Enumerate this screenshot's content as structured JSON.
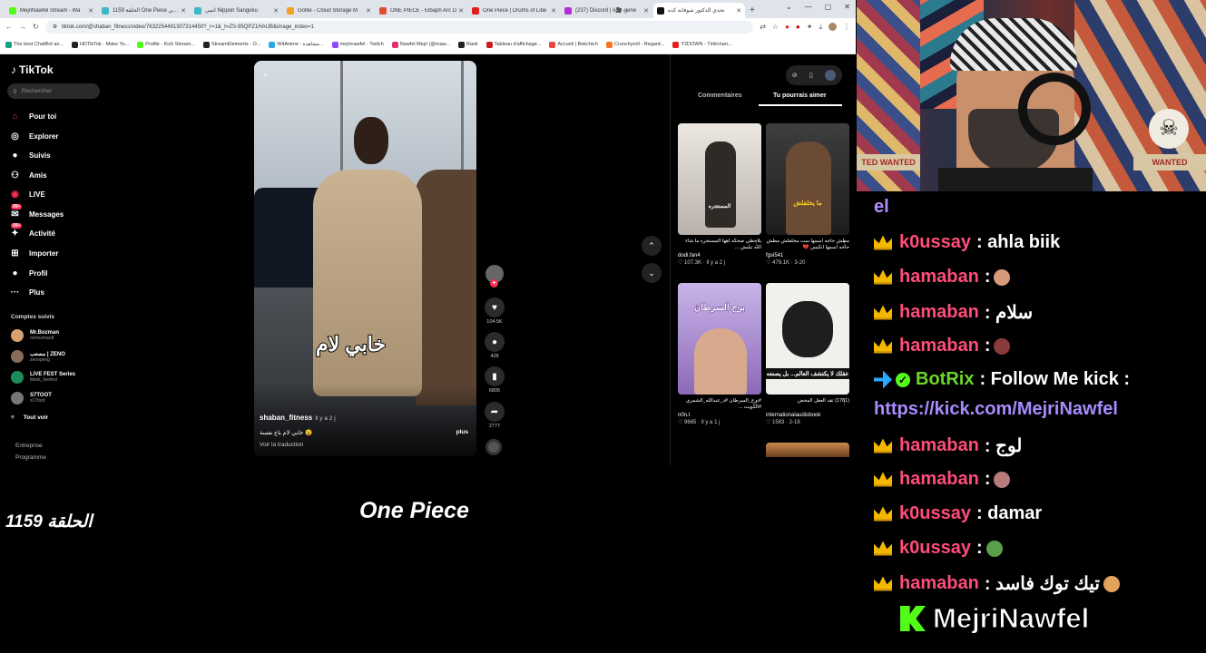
{
  "browser": {
    "tabs": [
      {
        "label": "MejriNawfel Stream - Wa",
        "color": "#53fc18"
      },
      {
        "label": "الحلقة 1159 One Piece الحي",
        "color": "#3db8c9"
      },
      {
        "label": "انمي Nippon Sangoku",
        "color": "#3db8c9"
      },
      {
        "label": "Gofile - Cloud Storage M",
        "color": "#f4a025"
      },
      {
        "label": "ONE PIECE - Elbaph Arc D",
        "color": "#e34b2f"
      },
      {
        "label": "One Piece | Drums of Libe",
        "color": "#e02020"
      },
      {
        "label": "(237) Discord | #🎥-gene",
        "color": "#b12fd4"
      },
      {
        "label": "تحدي الدكتور شوفانه كده",
        "color": "#111111",
        "active": true
      }
    ],
    "url": "tiktok.com/@shaban_fitness/video/7632254491307314450?_r=1&_t=ZS-95QPZ1HAUB&image_index=1",
    "bookmarks": [
      {
        "label": "The best ChatBot an...",
        "color": "#10a37f"
      },
      {
        "label": "HDTikTok - Make Yo...",
        "color": "#222222"
      },
      {
        "label": "Profile - Kick Stream...",
        "color": "#53fc18"
      },
      {
        "label": "StreamElements - O...",
        "color": "#222222"
      },
      {
        "label": "WitAnime - مشاهدة...",
        "color": "#2ca9e1"
      },
      {
        "label": "mejrinawfel - Twitch",
        "color": "#9146ff"
      },
      {
        "label": "Nawfel Mejri (@maw...",
        "color": "#e1306c"
      },
      {
        "label": "Rank",
        "color": "#222222"
      },
      {
        "label": "Tableau d'affichage...",
        "color": "#c41e1e"
      },
      {
        "label": "Accueil | Bekchich",
        "color": "#e8473c"
      },
      {
        "label": "Crunchyroll - Regard...",
        "color": "#f47521"
      },
      {
        "label": "Y2DOWN - Télécharr...",
        "color": "#e02020"
      }
    ]
  },
  "tiktok": {
    "logo": "TikTok",
    "search_placeholder": "Rechercher",
    "nav": [
      {
        "label": "Pour toi",
        "icon": "home-icon",
        "glyph": "⌂"
      },
      {
        "label": "Explorer",
        "icon": "compass-icon",
        "glyph": "◎"
      },
      {
        "label": "Suivis",
        "icon": "following-icon",
        "glyph": "●"
      },
      {
        "label": "Amis",
        "icon": "friends-icon",
        "glyph": "⚇"
      },
      {
        "label": "LIVE",
        "icon": "live-icon",
        "glyph": "◉"
      },
      {
        "label": "Messages",
        "icon": "messages-icon",
        "glyph": "✉",
        "badge": "99+"
      },
      {
        "label": "Activité",
        "icon": "activity-icon",
        "glyph": "✦",
        "badge": "99+"
      },
      {
        "label": "Importer",
        "icon": "upload-icon",
        "glyph": "⊞"
      },
      {
        "label": "Profil",
        "icon": "profile-icon",
        "glyph": "●"
      },
      {
        "label": "Plus",
        "icon": "more-icon",
        "glyph": "···"
      }
    ],
    "following_title": "Comptes suivis",
    "accounts": [
      {
        "name": "Mr.Bozman",
        "handle": "mrbozman8"
      },
      {
        "name": "مصعب | ZENO",
        "handle": "zenopeng"
      },
      {
        "name": "LIVE FEST Series",
        "handle": "tiktok_livefest"
      },
      {
        "name": "S7TOOT",
        "handle": "s17toot"
      }
    ],
    "see_all": "Tout voir",
    "footer": [
      "Entreprise",
      "Programme"
    ],
    "video": {
      "caption": "خابي لام",
      "author": "shaban_fitness",
      "ago": "Il y a 2 j",
      "description": "خابي لام باع نفسة 😮",
      "translate": "Voir la traduction",
      "more": "plus"
    },
    "actions": [
      {
        "icon": "heart-icon",
        "glyph": "♥",
        "count": "104.5K"
      },
      {
        "icon": "comment-icon",
        "glyph": "●",
        "count": "428"
      },
      {
        "icon": "bookmark-icon",
        "glyph": "▮",
        "count": "6805"
      },
      {
        "icon": "share-icon",
        "glyph": "➦",
        "count": "2777"
      }
    ],
    "right_tabs": {
      "comments": "Commentaires",
      "you_may_like": "Tu pourrais aimer"
    },
    "recommended": [
      {
        "title": "يلاحظي ضحكه اهها المستجره ما شاء الله تبليش ...",
        "author": "dodi.fan4",
        "stats": "♡ 107.3K · Il y a 2 j",
        "overlay": "المستجره"
      },
      {
        "title": "مطش حاجه اسمها ست مخلفلش مطش حاجه اسمها انكيس 💔",
        "author": "fgsi541",
        "stats": "♡ 479.1K · 3-20",
        "overlay": "ما يخلفلش"
      },
      {
        "title": "#برج_السرطان #د_عبدالله_الشمري #الكويت ...",
        "author": "n0n.t",
        "stats": "♡ 9665 · Il y a 1 j",
        "overlay": "برج السرطان"
      },
      {
        "title": "(1781) تقد العقل المحض",
        "author": "internationalaudiobook",
        "stats": "♡ 1583 · 2-18",
        "overlay": "عقلك لا يكتشف العالم... بل يصنعه"
      }
    ]
  },
  "overlay": {
    "episode": "الحلقة 1159",
    "show": "One Piece"
  },
  "chat": {
    "partial_line": "el",
    "messages": [
      {
        "user": "k0ussay",
        "text": ": ahla biik",
        "emoji": ""
      },
      {
        "user": "hamaban",
        "text": ":",
        "emoji": "#d79a7a"
      },
      {
        "user": "hamaban",
        "text": ": سلام",
        "emoji": ""
      },
      {
        "user": "hamaban",
        "text": ":",
        "emoji": "#8a3c3c"
      },
      {
        "user": "hamaban",
        "text": ": لوج",
        "emoji": ""
      },
      {
        "user": "hamaban",
        "text": ":",
        "emoji": "#b97b7b"
      },
      {
        "user": "k0ussay",
        "text": ": damar",
        "emoji": ""
      },
      {
        "user": "k0ussay",
        "text": ":",
        "emoji": "#5aa04a"
      },
      {
        "user": "hamaban",
        "text": ": تيك توك فاسد",
        "emoji": "#e3a35c"
      }
    ],
    "bot": {
      "user": "BotRix",
      "text": ": Follow Me kick :",
      "link": "https://kick.com/MejriNawfel"
    },
    "channel": "MejriNawfel"
  },
  "colors": {
    "tiktok_accent": "#fe2c55",
    "kick_green": "#53fc18",
    "chat_user": "#ff4d7a",
    "crown": "#f5b800"
  }
}
